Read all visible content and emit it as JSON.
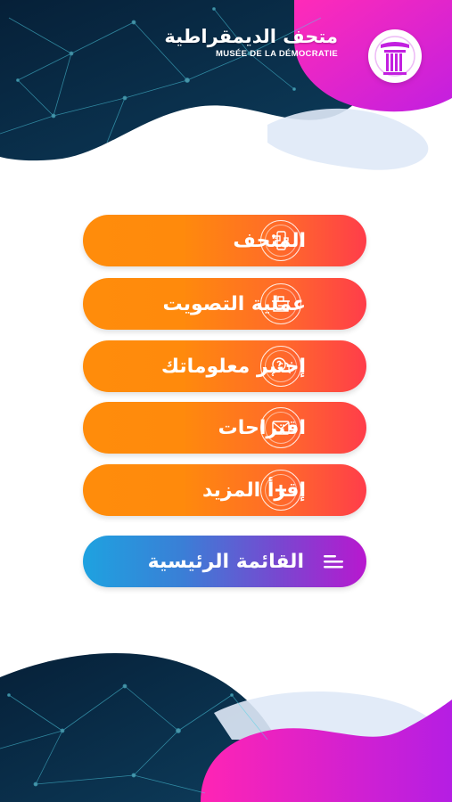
{
  "header": {
    "logo_arabic": "متحف الديمقراطية",
    "logo_french": "MUSÉE DE LA DÉMOCRATIE",
    "logo_icon": "column-pillar-icon"
  },
  "menu": {
    "items": [
      {
        "label": "المتحف",
        "icon": "museum-map-phone-icon"
      },
      {
        "label": "عملية التصويت",
        "icon": "ballot-box-icon"
      },
      {
        "label": "إختبر معلوماتك",
        "icon": "quiz-chat-bubbles-icon"
      },
      {
        "label": "اقتراحات",
        "icon": "envelope-icon"
      },
      {
        "label": "إقرأ المزيد",
        "icon": "plus-icon"
      }
    ],
    "main_menu": {
      "label": "القائمة الرئيسية",
      "icon": "hamburger-menu-icon"
    }
  },
  "colors": {
    "orange": "#ff8c0b",
    "red": "#ff3d4a",
    "magenta": "#e31fd0",
    "blue": "#1ea2e0",
    "purple": "#b818cf",
    "navy": "#0b2a45"
  }
}
